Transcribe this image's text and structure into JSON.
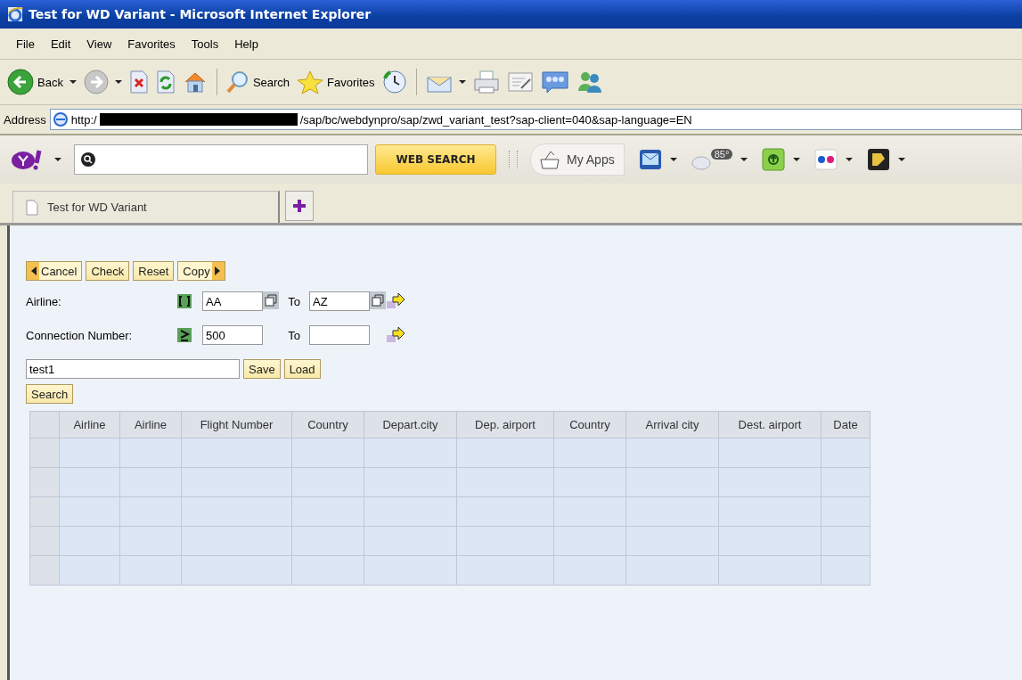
{
  "window": {
    "title": "Test for WD Variant - Microsoft Internet Explorer"
  },
  "menu": [
    "File",
    "Edit",
    "View",
    "Favorites",
    "Tools",
    "Help"
  ],
  "toolbar": [
    {
      "kind": "back",
      "label": "Back",
      "dropdown": true
    },
    {
      "kind": "forward",
      "dropdown": true
    },
    {
      "kind": "stop"
    },
    {
      "kind": "refresh"
    },
    {
      "kind": "home"
    },
    {
      "kind": "separator"
    },
    {
      "kind": "search",
      "label": "Search"
    },
    {
      "kind": "favorites",
      "label": "Favorites"
    },
    {
      "kind": "history"
    },
    {
      "kind": "separator"
    },
    {
      "kind": "mail",
      "dropdown": true
    },
    {
      "kind": "print"
    },
    {
      "kind": "edit"
    },
    {
      "kind": "discuss"
    },
    {
      "kind": "messenger"
    }
  ],
  "address": {
    "label": "Address",
    "url_start": "http:/",
    "redacted": true,
    "url_end": "/sap/bc/webdynpro/sap/zwd_variant_test?sap-client=040&sap-language=EN"
  },
  "yahoo_toolbar": {
    "search_button": "WEB SEARCH",
    "apps_label": "My Apps",
    "weather": "85°"
  },
  "tabs": [
    {
      "label": "Test for WD Variant",
      "selected": true
    }
  ],
  "page": {
    "action_buttons": [
      {
        "label": "Cancel",
        "kind": "first"
      },
      {
        "label": "Check",
        "kind": "middle"
      },
      {
        "label": "Reset",
        "kind": "middle"
      },
      {
        "label": "Copy",
        "kind": "last"
      }
    ],
    "criteria": [
      {
        "label": "Airline:",
        "kind": "between",
        "from": "AA",
        "to_label": "To",
        "to": "AZ",
        "value_help": true
      },
      {
        "label": "Connection Number:",
        "kind": "greater_equal",
        "from": "500",
        "to_label": "To",
        "value_help": false
      }
    ],
    "variant_name": "test1",
    "variant_buttons": [
      "Save",
      "Load"
    ],
    "search_button": "Search",
    "table": {
      "columns": [
        "Airline",
        "Airline",
        "Flight Number",
        "Country",
        "Depart.city",
        "Dep. airport",
        "Country",
        "Arrival city",
        "Dest. airport",
        "Date"
      ],
      "rows": [
        {
          "selected": false
        },
        {
          "selected": false
        },
        {
          "selected": false
        },
        {
          "selected": false
        },
        {
          "selected": false
        }
      ]
    }
  }
}
